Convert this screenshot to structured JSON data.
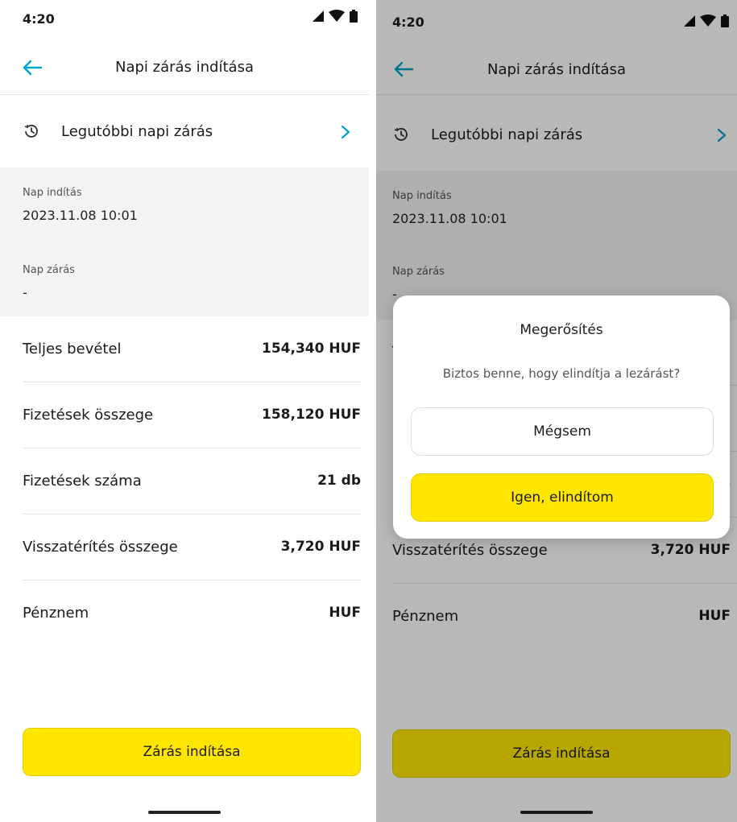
{
  "status_bar": {
    "time": "4:20",
    "icons": [
      "signal-icon",
      "wifi-icon",
      "battery-icon"
    ]
  },
  "header": {
    "title": "Napi zárás indítása",
    "back_icon": "arrow-left-icon"
  },
  "recent": {
    "label": "Legutóbbi napi zárás",
    "icon": "history-icon",
    "chevron": "chevron-right-icon"
  },
  "day_info": {
    "start_label": "Nap indítás",
    "start_value": "2023.11.08 10:01",
    "close_label": "Nap zárás",
    "close_value": "-"
  },
  "summary": [
    {
      "label": "Teljes bevétel",
      "value": "154,340 HUF"
    },
    {
      "label": "Fizetések összege",
      "value": "158,120 HUF"
    },
    {
      "label": "Fizetések száma",
      "value": "21 db"
    },
    {
      "label": "Visszatérítés összege",
      "value": "3,720 HUF"
    },
    {
      "label": "Pénznem",
      "value": "HUF"
    }
  ],
  "primary_button": {
    "label": "Zárás indítása"
  },
  "dialog": {
    "title": "Megerősítés",
    "message": "Biztos benne, hogy elindítja a lezárást?",
    "cancel_label": "Mégsem",
    "confirm_label": "Igen, elindítom"
  },
  "colors": {
    "accent": "#ffe600",
    "back_arrow": "#00a5c8",
    "overlay": "rgba(0,0,0,0.28)"
  }
}
